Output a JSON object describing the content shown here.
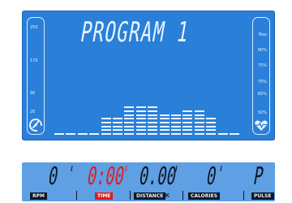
{
  "display": {
    "program_title": "PROGRAM 1",
    "left_scale": [
      "250",
      "170",
      "90",
      "20"
    ],
    "right_scale": [
      "Max",
      "80%",
      "75%",
      "70%",
      "65%",
      "50%"
    ],
    "colors": {
      "lcd_background": "#2a7fd8",
      "segment": "#eaf5ff",
      "strip_background": "#5f9fe4",
      "time_highlight": "#e11b1b"
    },
    "left_icon": "speed-gauge-icon",
    "right_icon": "heart-rate-icon",
    "profile_levels": [
      1,
      1,
      1,
      1,
      5,
      5,
      8,
      8,
      8,
      6,
      6,
      7,
      7,
      5,
      1,
      1
    ]
  },
  "readouts": {
    "rpm": {
      "value": "0",
      "label": "RPM"
    },
    "time": {
      "value": "0:00",
      "label": "TIME"
    },
    "distance": {
      "value": "0.00",
      "label": "DISTANCE",
      "unit": "K"
    },
    "calories": {
      "value": "0",
      "label": "CALORIES"
    },
    "pulse": {
      "value": "P",
      "label": "PULSE"
    }
  }
}
